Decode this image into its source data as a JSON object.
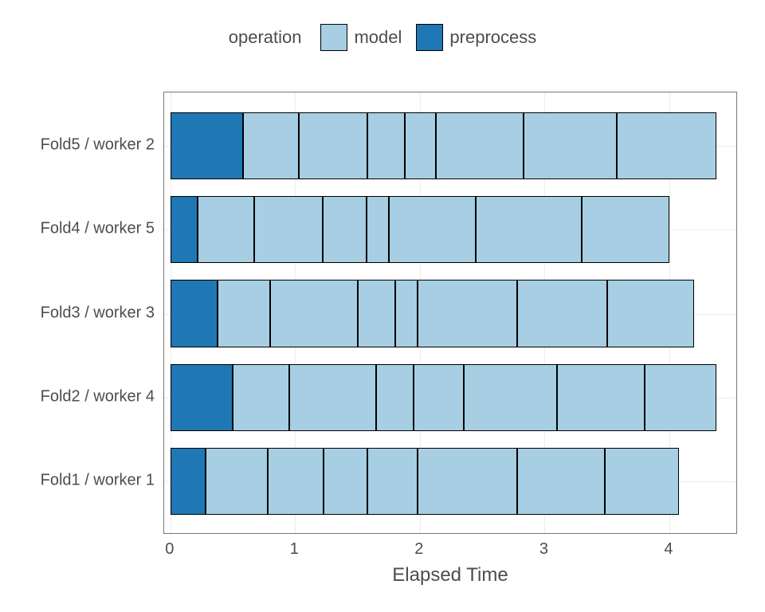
{
  "legend": {
    "title": "operation",
    "items": [
      {
        "label": "model",
        "color": "#a7cee2"
      },
      {
        "label": "preprocess",
        "color": "#1f78b4"
      }
    ]
  },
  "xaxis_title": "Elapsed Time",
  "xticks": [
    "0",
    "1",
    "2",
    "3",
    "4"
  ],
  "ylabels": [
    "Fold5 / worker 2",
    "Fold4 / worker 5",
    "Fold3 / worker 3",
    "Fold2 / worker 4",
    "Fold1 / worker 1"
  ],
  "chart_data": {
    "type": "bar",
    "xlabel": "Elapsed Time",
    "ylabel": "",
    "xlim": [
      -0.05,
      4.55
    ],
    "legend_position": "top",
    "categories": [
      "Fold1 / worker 1",
      "Fold2 / worker 4",
      "Fold3 / worker 3",
      "Fold4 / worker 5",
      "Fold5 / worker 2"
    ],
    "series_note": "Each row is a stacked set of segments: first segment is 'preprocess', remaining segments are successive 'model' operations. Widths are elapsed-time durations.",
    "rows": [
      {
        "category": "Fold1 / worker 1",
        "segments": [
          {
            "operation": "preprocess",
            "width": 0.28
          },
          {
            "operation": "model",
            "width": 0.5
          },
          {
            "operation": "model",
            "width": 0.45
          },
          {
            "operation": "model",
            "width": 0.35
          },
          {
            "operation": "model",
            "width": 0.4
          },
          {
            "operation": "model",
            "width": 0.8
          },
          {
            "operation": "model",
            "width": 0.7
          },
          {
            "operation": "model",
            "width": 0.6
          }
        ]
      },
      {
        "category": "Fold2 / worker 4",
        "segments": [
          {
            "operation": "preprocess",
            "width": 0.5
          },
          {
            "operation": "model",
            "width": 0.45
          },
          {
            "operation": "model",
            "width": 0.7
          },
          {
            "operation": "model",
            "width": 0.3
          },
          {
            "operation": "model",
            "width": 0.4
          },
          {
            "operation": "model",
            "width": 0.75
          },
          {
            "operation": "model",
            "width": 0.7
          },
          {
            "operation": "model",
            "width": 0.58
          }
        ]
      },
      {
        "category": "Fold3 / worker 3",
        "segments": [
          {
            "operation": "preprocess",
            "width": 0.38
          },
          {
            "operation": "model",
            "width": 0.42
          },
          {
            "operation": "model",
            "width": 0.7
          },
          {
            "operation": "model",
            "width": 0.3
          },
          {
            "operation": "model",
            "width": 0.18
          },
          {
            "operation": "model",
            "width": 0.8
          },
          {
            "operation": "model",
            "width": 0.72
          },
          {
            "operation": "model",
            "width": 0.7
          }
        ]
      },
      {
        "category": "Fold4 / worker 5",
        "segments": [
          {
            "operation": "preprocess",
            "width": 0.22
          },
          {
            "operation": "model",
            "width": 0.45
          },
          {
            "operation": "model",
            "width": 0.55
          },
          {
            "operation": "model",
            "width": 0.35
          },
          {
            "operation": "model",
            "width": 0.18
          },
          {
            "operation": "model",
            "width": 0.7
          },
          {
            "operation": "model",
            "width": 0.85
          },
          {
            "operation": "model",
            "width": 0.7
          }
        ]
      },
      {
        "category": "Fold5 / worker 2",
        "segments": [
          {
            "operation": "preprocess",
            "width": 0.58
          },
          {
            "operation": "model",
            "width": 0.45
          },
          {
            "operation": "model",
            "width": 0.55
          },
          {
            "operation": "model",
            "width": 0.3
          },
          {
            "operation": "model",
            "width": 0.25
          },
          {
            "operation": "model",
            "width": 0.7
          },
          {
            "operation": "model",
            "width": 0.75
          },
          {
            "operation": "model",
            "width": 0.8
          }
        ]
      }
    ]
  }
}
